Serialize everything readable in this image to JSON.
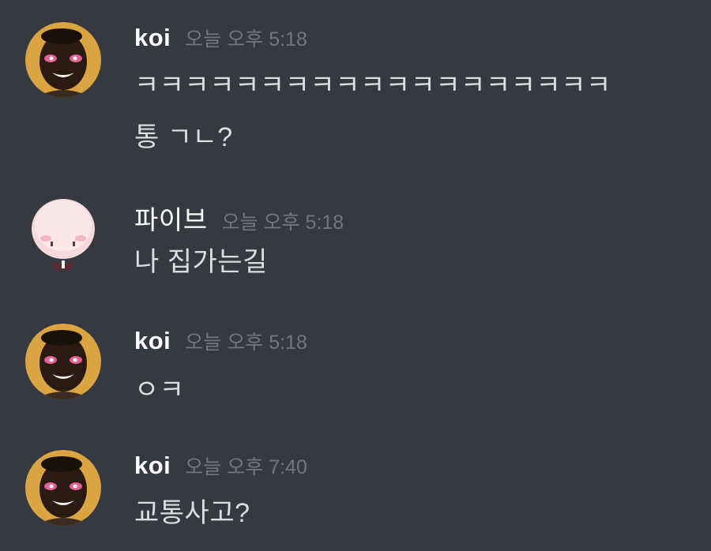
{
  "messages": [
    {
      "author": "koi",
      "timestamp": "오늘 오후 5:18",
      "lines": [
        "ㅋㅋㅋㅋㅋㅋㅋㅋㅋㅋㅋㅋㅋㅋㅋㅋㅋㅋㅋ",
        "통 ㄱㄴ?"
      ]
    },
    {
      "author": "파이브",
      "timestamp": "오늘 오후 5:18",
      "lines": [
        "나 집가는길"
      ]
    },
    {
      "author": "koi",
      "timestamp": "오늘 오후 5:18",
      "lines": [
        "ㅇㅋ"
      ]
    },
    {
      "author": "koi",
      "timestamp": "오늘 오후 7:40",
      "lines": [
        "교통사고?"
      ]
    }
  ],
  "colors": {
    "background": "#36393f",
    "username": "#ffffff",
    "timestamp": "#72767d",
    "message_text": "#dcddde"
  },
  "icons": {
    "koi_avatar": "avatar-dark-face-blush",
    "five_avatar": "avatar-round-pink-character"
  }
}
